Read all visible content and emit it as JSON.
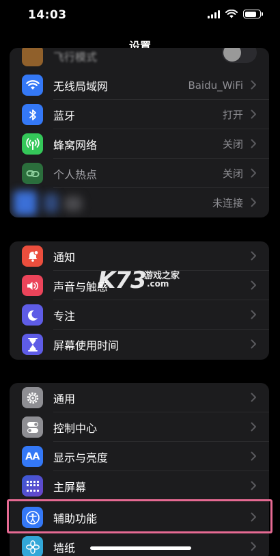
{
  "status_bar": {
    "time": "14:03"
  },
  "nav": {
    "title": "设置"
  },
  "group1": {
    "airplane": {
      "label": "飞行模式"
    },
    "wifi": {
      "label": "无线局域网",
      "value": "Baidu_WiFi"
    },
    "bluetooth": {
      "label": "蓝牙",
      "value": "打开"
    },
    "cellular": {
      "label": "蜂窝网络",
      "value": "关闭"
    },
    "hotspot": {
      "label": "个人热点",
      "value": "关闭"
    },
    "vpn": {
      "value": "未连接"
    }
  },
  "group2": {
    "notifications": {
      "label": "通知"
    },
    "sounds": {
      "label": "声音与触感"
    },
    "focus": {
      "label": "专注"
    },
    "screentime": {
      "label": "屏幕使用时间"
    }
  },
  "group3": {
    "general": {
      "label": "通用"
    },
    "control_center": {
      "label": "控制中心"
    },
    "display": {
      "label": "显示与亮度",
      "icon_text": "AA"
    },
    "home_screen": {
      "label": "主屏幕"
    },
    "accessibility": {
      "label": "辅助功能"
    },
    "wallpaper": {
      "label": "墙纸"
    }
  },
  "watermark": {
    "brand": "K73",
    "site": "游戏之家",
    "domain": ".com"
  },
  "colors": {
    "orange": "#f09a37",
    "blue": "#3478f6",
    "green": "#34c759",
    "red": "#eb4e3d",
    "pink_red": "#eb445a",
    "purple": "#5e5ce6",
    "gray": "#8e8e93",
    "highlight": "#e66a93"
  }
}
